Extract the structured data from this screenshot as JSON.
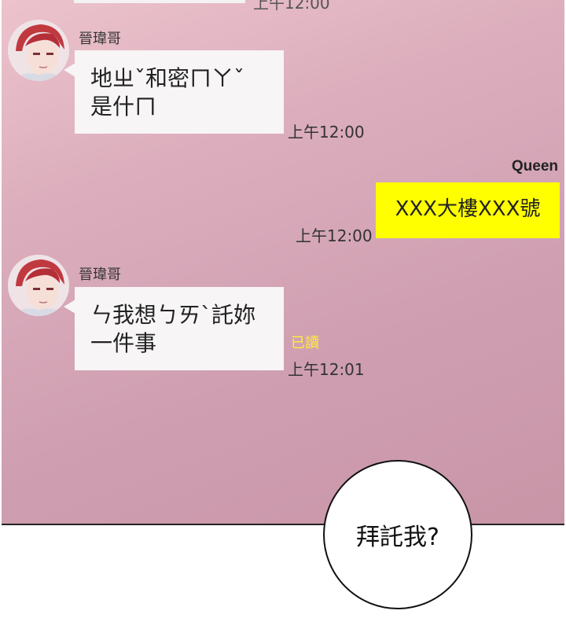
{
  "conversation": {
    "top_partial_time": "上午12:00",
    "messages": [
      {
        "sender": "晉瑋哥",
        "line1": "地ㄓˇ和密ㄇㄚˇ",
        "line2": "是什ㄇ",
        "time": "上午12:00"
      },
      {
        "sender": "Queen",
        "text": "XXX大樓XXX號",
        "time": "上午12:00"
      },
      {
        "sender": "晉瑋哥",
        "line1": "ㄣ我想ㄅㄞˋ託妳",
        "line2": "一件事",
        "read_status": "已讀",
        "time": "上午12:01"
      }
    ]
  },
  "narration": {
    "speech_bubble": "拜託我?"
  },
  "colors": {
    "chat_background": "#d4a4b6",
    "incoming_bubble": "#f7f5f6",
    "outgoing_bubble": "#ffff00",
    "read_mark": "#ffef3a"
  }
}
